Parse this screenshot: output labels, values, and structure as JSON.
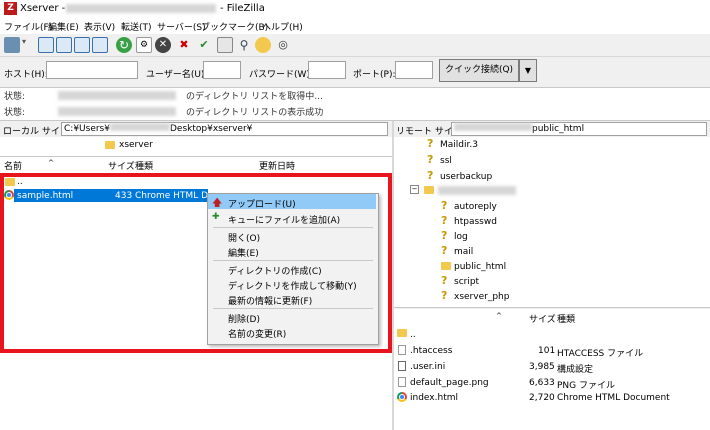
{
  "title": {
    "prefix": "Xserver -",
    "suffix": "- FileZilla",
    "icon": "filezilla-icon"
  },
  "menu": [
    "ファイル(F)",
    "編集(E)",
    "表示(V)",
    "転送(T)",
    "サーバー(S)",
    "ブックマーク(B)",
    "ヘルプ(H)"
  ],
  "quickconnect": {
    "host_label": "ホスト(H):",
    "user_label": "ユーザー名(U):",
    "pass_label": "パスワード(W):",
    "port_label": "ポート(P):",
    "button": "クイック接続(Q)",
    "dropdown": "▼"
  },
  "log": [
    {
      "label": "状態:",
      "text": "のディレクトリ リストを取得中..."
    },
    {
      "label": "状態:",
      "text": "のディレクトリ リストの表示成功"
    }
  ],
  "local": {
    "site_label": "ローカル サイト:",
    "path_start": "C:¥Users¥",
    "path_end": "Desktop¥xserver¥",
    "tree_item": "xserver",
    "columns": {
      "name": "名前",
      "size": "サイズ",
      "type": "種類",
      "modified": "更新日時"
    },
    "rows": [
      {
        "name": "..",
        "size": "",
        "type": ""
      },
      {
        "name": "sample.html",
        "size": "433",
        "type": "Chrome HTML D"
      }
    ]
  },
  "remote": {
    "site_label": "リモート サイト:",
    "path_end": "public_html",
    "tree": [
      "Maildir.3",
      "ssl",
      "userbackup",
      "autoreply",
      "htpasswd",
      "log",
      "mail",
      "public_html",
      "script",
      "xserver_php"
    ],
    "columns": {
      "size": "サイズ",
      "type": "種類"
    },
    "rows": [
      {
        "name": "..",
        "size": "",
        "type": ""
      },
      {
        "name": ".htaccess",
        "size": "101",
        "type": "HTACCESS ファイル"
      },
      {
        "name": ".user.ini",
        "size": "3,985",
        "type": "構成設定"
      },
      {
        "name": "default_page.png",
        "size": "6,633",
        "type": "PNG ファイル"
      },
      {
        "name": "index.html",
        "size": "2,720",
        "type": "Chrome HTML Document"
      }
    ]
  },
  "context_menu": [
    "アップロード(U)",
    "キューにファイルを追加(A)",
    "開く(O)",
    "編集(E)",
    "ディレクトリの作成(C)",
    "ディレクトリを作成して移動(Y)",
    "最新の情報に更新(F)",
    "削除(D)",
    "名前の変更(R)"
  ],
  "colors": {
    "highlight_frame": "#e8141e",
    "selection": "#0078d7",
    "menu_highlight": "#91c9f7"
  }
}
